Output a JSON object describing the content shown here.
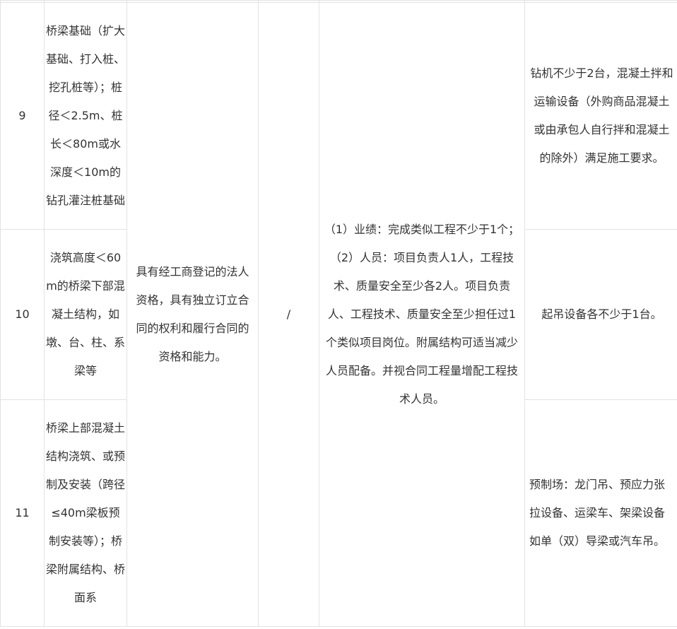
{
  "table": {
    "rows": [
      {
        "no": "9",
        "scope": "桥梁基础（扩大基础、打入桩、挖孔桩等）；桩径＜2.5m、桩长＜80m或水深度＜10m的钻孔灌注桩基础",
        "equipment": "钻机不少于2台，混凝土拌和运输设备（外购商品混凝土或由承包人自行拌和混凝土的除外）满足施工要求。"
      },
      {
        "no": "10",
        "scope": "浇筑高度＜60m的桥梁下部混凝土结构，如墩、台、柱、系梁等",
        "equipment": "起吊设备各不少于1台。"
      },
      {
        "no": "11",
        "scope": "桥梁上部混凝土结构浇筑、或预制及安装（跨径≤40m梁板预制安装等）；桥梁附属结构、桥面系",
        "equipment": "预制场：龙门吊、预应力张拉设备、运梁车、架梁设备如单（双）导梁或汽车吊。"
      }
    ],
    "qualification": "具有经工商登记的法人资格，具有独立订立合同的权利和履行合同的资格和能力。",
    "certificate": "/",
    "requirement": "（1）业绩：完成类似工程不少于1个；（2）人员：项目负责人1人，工程技术、质量安全至少各2人。项目负责人、工程技术、质量安全至少担任过1个类似项目岗位。附属结构可适当减少人员配备。并视合同工程量增配工程技术人员。"
  }
}
